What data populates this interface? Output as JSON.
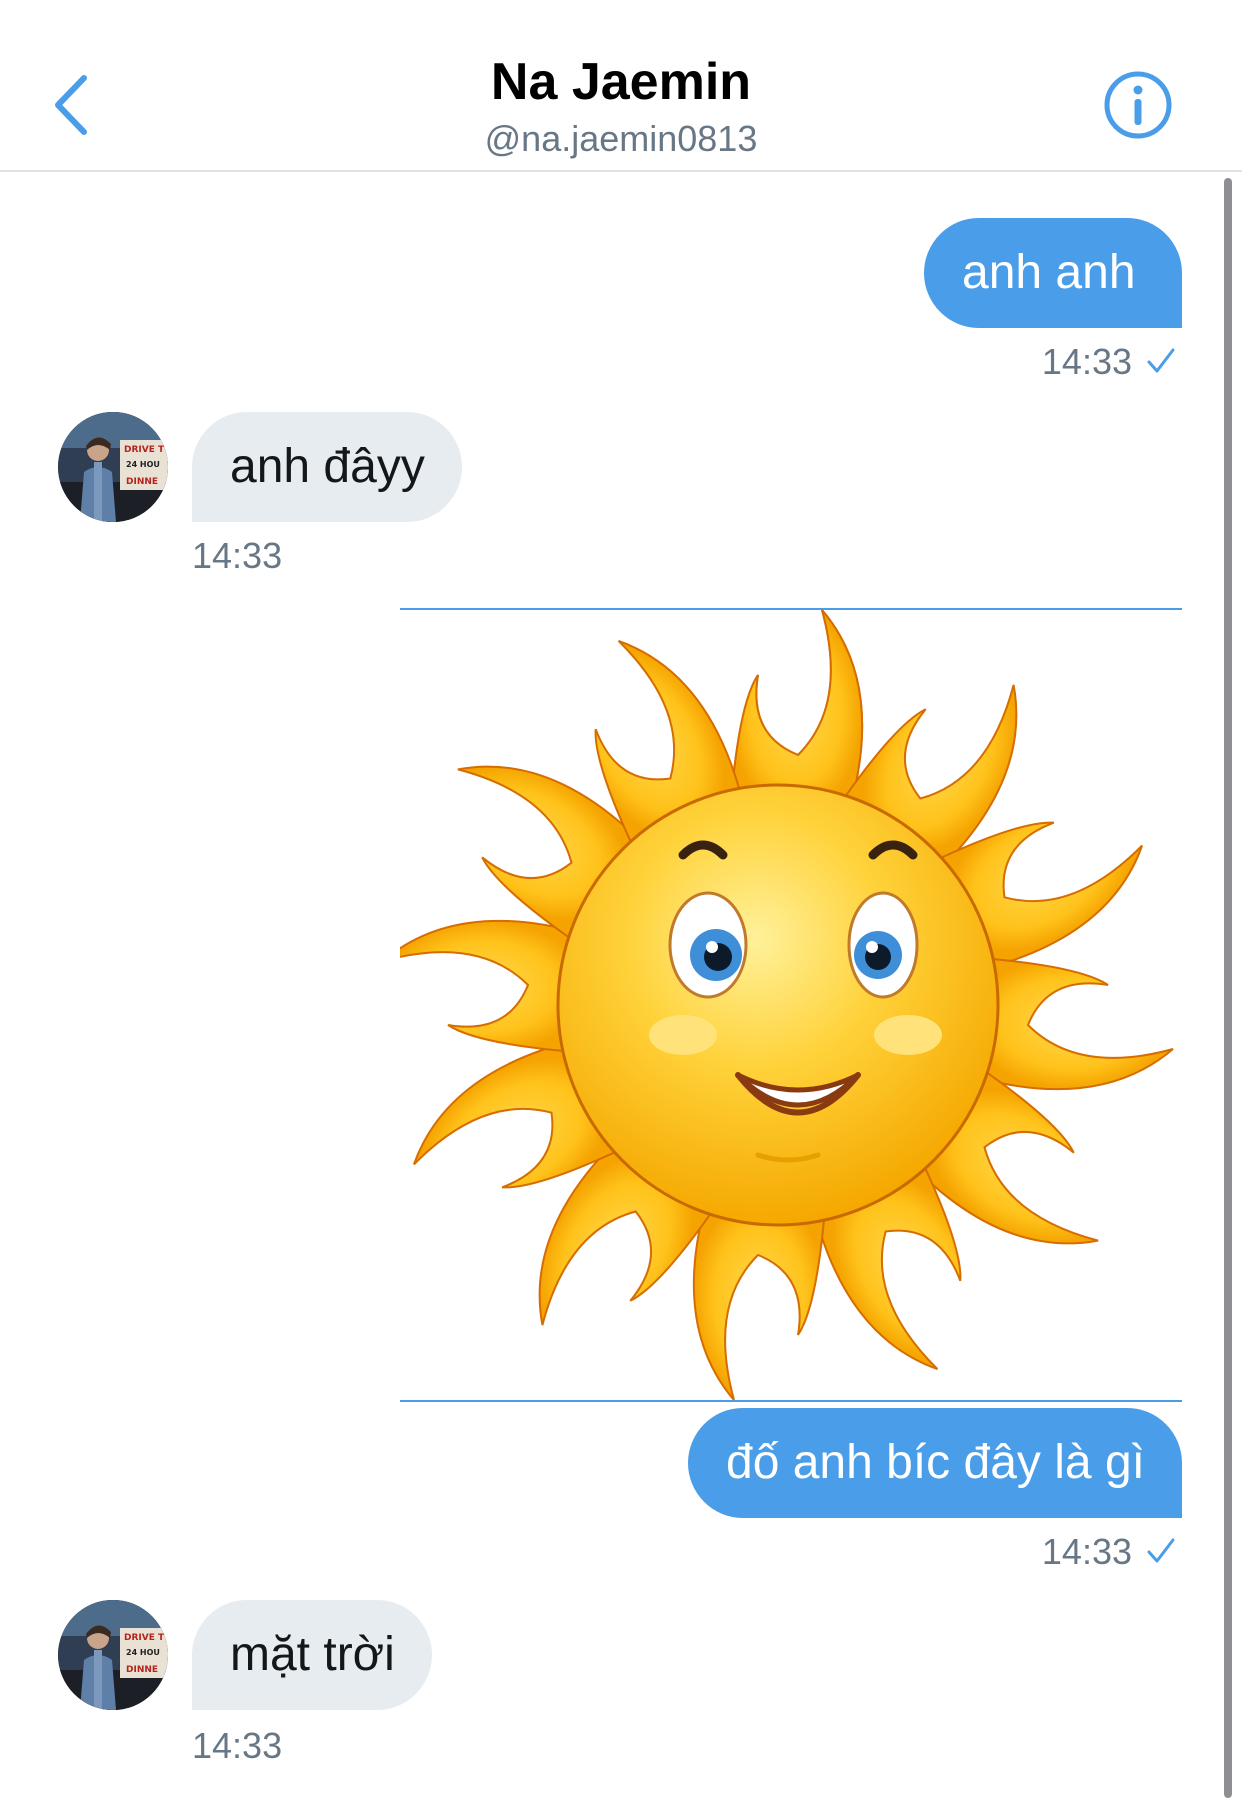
{
  "header": {
    "title": "Na Jaemin",
    "handle": "@na.jaemin0813",
    "icons": {
      "back": "chevron-left-icon",
      "info": "info-circle-icon"
    },
    "accent_color": "#4a9de8"
  },
  "messages": [
    {
      "direction": "outgoing",
      "text": "anh anh",
      "time": "14:33",
      "status": "sent-check-icon"
    },
    {
      "direction": "incoming",
      "text": "anh đâyy",
      "time": "14:33"
    },
    {
      "direction": "outgoing",
      "type": "image",
      "image": "smiling-sun-sticker"
    },
    {
      "direction": "outgoing",
      "text": "đố anh bíc đây là gì",
      "time": "14:33",
      "status": "sent-check-icon"
    },
    {
      "direction": "incoming",
      "text": "mặt trời",
      "time": "14:33"
    }
  ],
  "avatar": {
    "sign_lines": [
      "DRIVE T",
      "24 HOU",
      "DINNE"
    ]
  }
}
